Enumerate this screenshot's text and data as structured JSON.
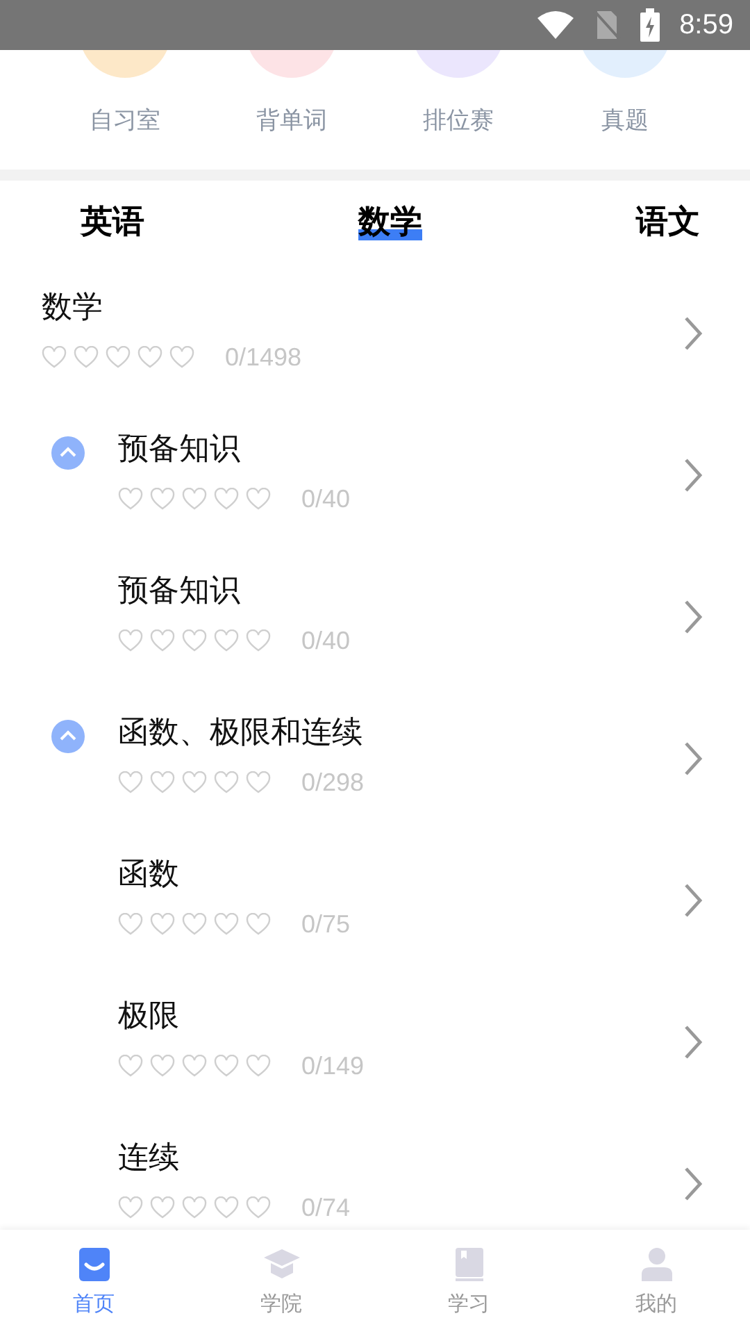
{
  "status_bar": {
    "time": "8:59"
  },
  "features": [
    {
      "label": "自习室",
      "color": "#fde8c8"
    },
    {
      "label": "背单词",
      "color": "#fde3e6"
    },
    {
      "label": "排位赛",
      "color": "#ebe6fd"
    },
    {
      "label": "真题",
      "color": "#e2effd"
    }
  ],
  "tabs": [
    {
      "label": "英语",
      "selected": false
    },
    {
      "label": "数学",
      "selected": true
    },
    {
      "label": "语文",
      "selected": false
    }
  ],
  "tree": [
    {
      "title": "数学",
      "stars": 0,
      "count": "0/1498",
      "children": [
        {
          "title": "预备知识",
          "stars": 0,
          "count": "0/40",
          "expanded": true,
          "children": [
            {
              "title": "预备知识",
              "stars": 0,
              "count": "0/40"
            }
          ]
        },
        {
          "title": "函数、极限和连续",
          "stars": 0,
          "count": "0/298",
          "expanded": true,
          "children": [
            {
              "title": "函数",
              "stars": 0,
              "count": "0/75"
            },
            {
              "title": "极限",
              "stars": 0,
              "count": "0/149"
            },
            {
              "title": "连续",
              "stars": 0,
              "count": "0/74"
            }
          ]
        }
      ]
    }
  ],
  "bottom_nav": [
    {
      "label": "首页",
      "kind": "home",
      "selected": true
    },
    {
      "label": "学院",
      "kind": "college",
      "selected": false
    },
    {
      "label": "学习",
      "kind": "study",
      "selected": false
    },
    {
      "label": "我的",
      "kind": "profile",
      "selected": false
    }
  ]
}
